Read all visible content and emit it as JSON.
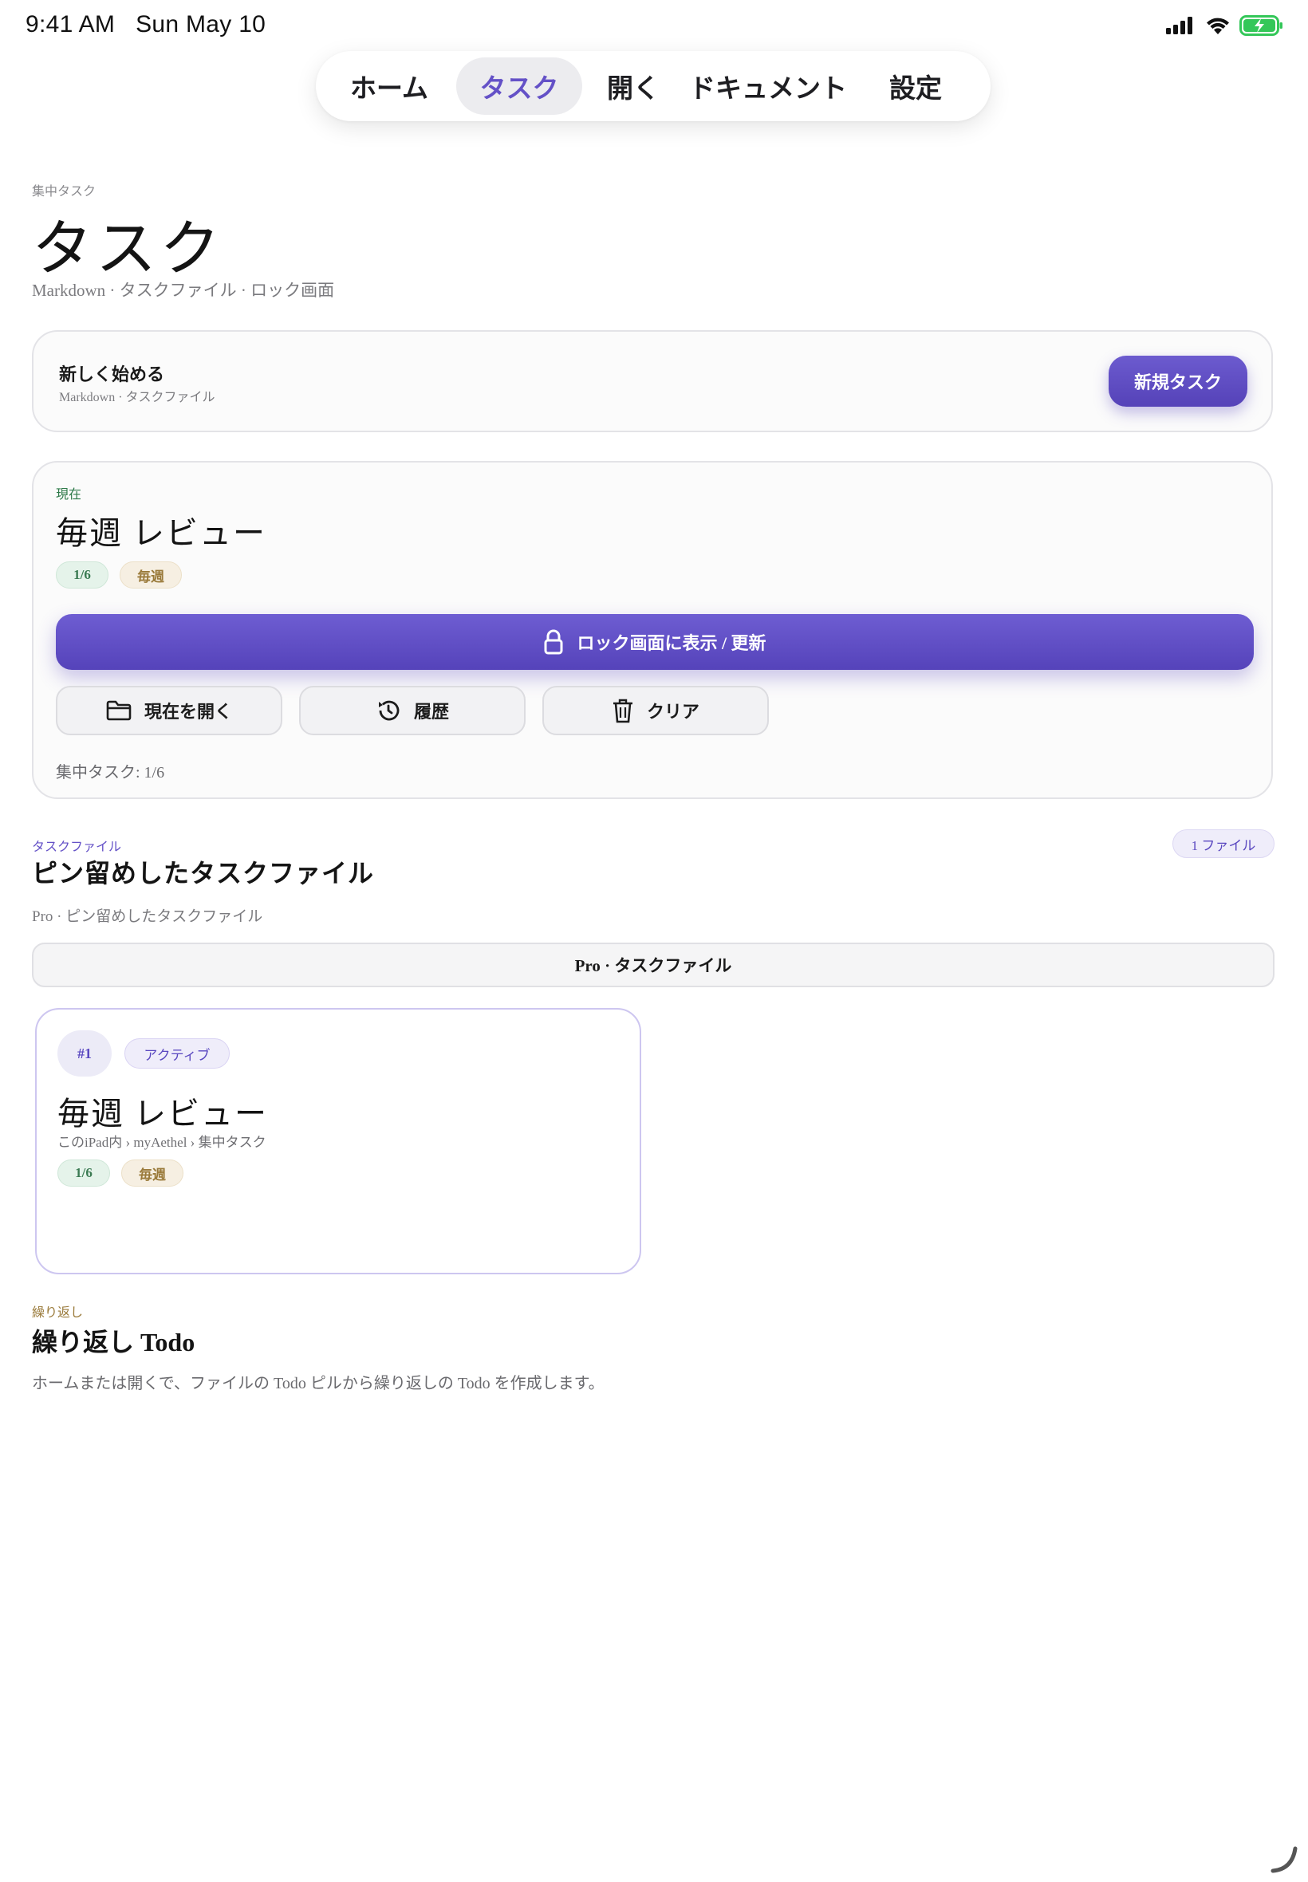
{
  "status": {
    "time": "9:41 AM",
    "date": "Sun May 10"
  },
  "nav": {
    "tabs": [
      "ホーム",
      "タスク",
      "開く",
      "ドキュメント",
      "設定"
    ],
    "active": "タスク"
  },
  "header": {
    "eyebrow": "集中タスク",
    "title": "タスク",
    "subtitle": "Markdown · タスクファイル · ロック画面"
  },
  "new_card": {
    "title": "新しく始める",
    "subtitle": "Markdown · タスクファイル",
    "button": "新規タスク"
  },
  "current": {
    "eyebrow": "現在",
    "title": "毎週 レビュー",
    "progress": "1/6",
    "recurrence": "毎週",
    "lock_button": "ロック画面に表示 / 更新",
    "open_button": "現在を開く",
    "history_button": "履歴",
    "clear_button": "クリア",
    "footer": "集中タスク: 1/6"
  },
  "files": {
    "eyebrow": "タスクファイル",
    "title": "ピン留めしたタスクファイル",
    "count": "1 ファイル",
    "subtitle": "Pro · ピン留めしたタスクファイル",
    "pro_bar": "Pro · タスクファイル",
    "items": [
      {
        "number": "#1",
        "state": "アクティブ",
        "title": "毎週 レビュー",
        "path": "このiPad内 › myAethel › 集中タスク",
        "progress": "1/6",
        "recurrence": "毎週"
      }
    ]
  },
  "repeat": {
    "eyebrow": "繰り返し",
    "title": "繰り返し Todo",
    "description": "ホームまたは開くで、ファイルの Todo ピルから繰り返しの Todo を作成します。"
  },
  "colors": {
    "accent": "#6451c7",
    "green": "#3a7a52",
    "tan": "#9a7a3a",
    "battery": "#34c759"
  }
}
